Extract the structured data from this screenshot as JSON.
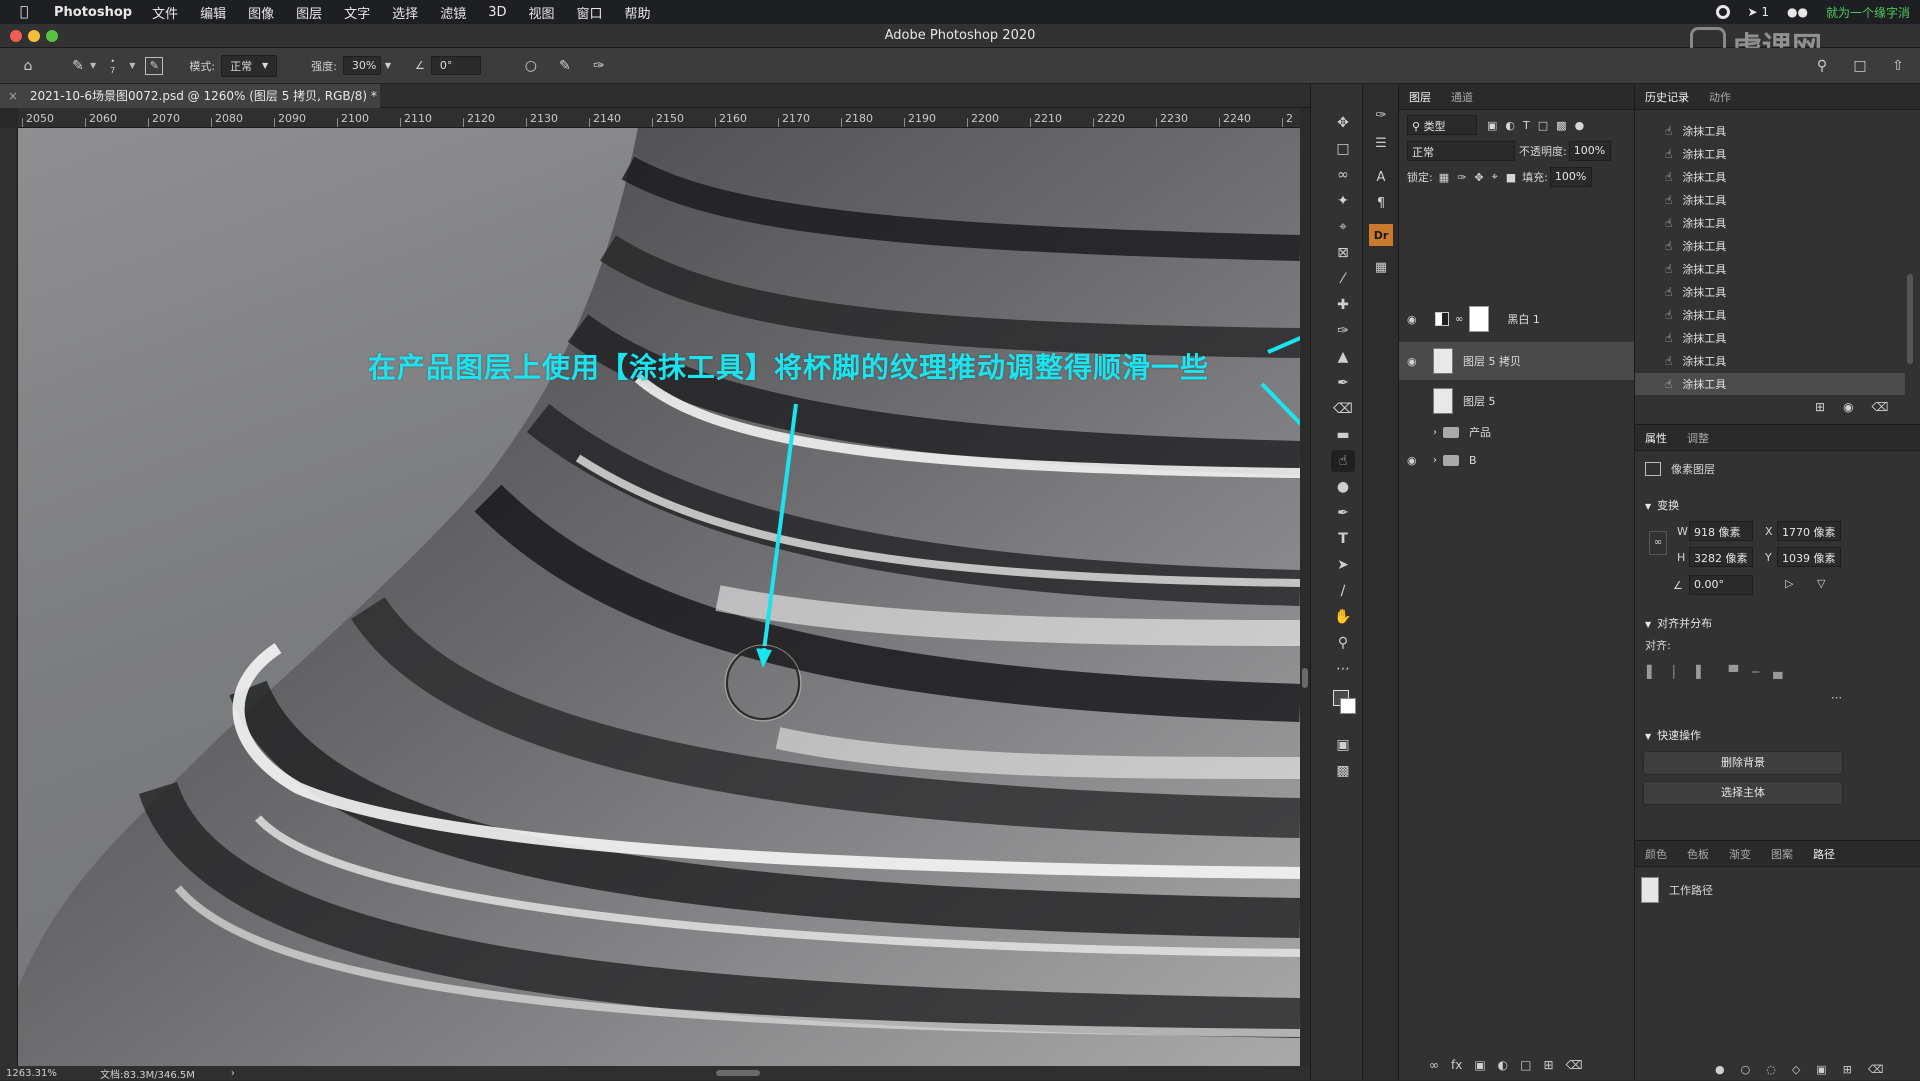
{
  "menubar": {
    "app_name": "Photoshop",
    "items": [
      "文件",
      "编辑",
      "图像",
      "图层",
      "文字",
      "选择",
      "滤镜",
      "3D",
      "视图",
      "窗口",
      "帮助"
    ],
    "right_text": "就为一个缘字消",
    "notification_count": "1"
  },
  "window": {
    "title": "Adobe Photoshop 2020"
  },
  "watermark": "虎课网",
  "options": {
    "mode_label": "模式:",
    "mode_value": "正常",
    "strength_label": "强度:",
    "strength_value": "30%",
    "angle_value": "0°",
    "brush_size": "7"
  },
  "document": {
    "tab_title": "2021-10-6场景图0072.psd @ 1260% (图层 5 拷贝, RGB/8) *",
    "zoom": "1263.31%",
    "doc_size": "文档:83.3M/346.5M"
  },
  "ruler": {
    "h_ticks": [
      "2050",
      "2060",
      "2070",
      "2080",
      "2090",
      "2100",
      "2110",
      "2120",
      "2130",
      "2140",
      "2150",
      "2160",
      "2170",
      "2180",
      "2190",
      "2200",
      "2210",
      "2220",
      "2230",
      "2240",
      "2"
    ]
  },
  "annotation": {
    "text": "在产品图层上使用【涂抹工具】将杯脚的纹理推动调整得顺滑一些",
    "color": "#19e4ef"
  },
  "layers_panel": {
    "tabs": [
      "图层",
      "通道"
    ],
    "filter_label": "类型",
    "blend_mode": "正常",
    "opacity_label": "不透明度:",
    "opacity_value": "100%",
    "lock_label": "锁定:",
    "fill_label": "填充:",
    "fill_value": "100%",
    "layers": [
      {
        "name": "黑白 1",
        "visible": true,
        "type": "adjustment"
      },
      {
        "name": "图层 5 拷贝",
        "visible": true,
        "type": "pixel",
        "selected": true
      },
      {
        "name": "图层 5",
        "visible": false,
        "type": "pixel"
      },
      {
        "name": "产品",
        "visible": false,
        "type": "group"
      },
      {
        "name": "B",
        "visible": true,
        "type": "group"
      }
    ]
  },
  "history_panel": {
    "tabs": [
      "历史记录",
      "动作"
    ],
    "items": [
      "涂抹工具",
      "涂抹工具",
      "涂抹工具",
      "涂抹工具",
      "涂抹工具",
      "涂抹工具",
      "涂抹工具",
      "涂抹工具",
      "涂抹工具",
      "涂抹工具",
      "涂抹工具",
      "涂抹工具"
    ]
  },
  "properties_panel": {
    "tabs": [
      "属性",
      "调整"
    ],
    "layer_kind": "像素图层",
    "transform_title": "变换",
    "w_label": "W",
    "w_value": "918 像素",
    "h_label": "H",
    "h_value": "3282 像素",
    "x_label": "X",
    "x_value": "1770 像素",
    "y_label": "Y",
    "y_value": "1039 像素",
    "angle_value": "0.00°",
    "align_title": "对齐并分布",
    "align_label": "对齐:",
    "quick_title": "快速操作",
    "remove_bg": "删除背景",
    "select_subject": "选择主体"
  },
  "paths_panel": {
    "tabs": [
      "颜色",
      "色板",
      "渐变",
      "图案",
      "路径"
    ],
    "path_name": "工作路径"
  }
}
